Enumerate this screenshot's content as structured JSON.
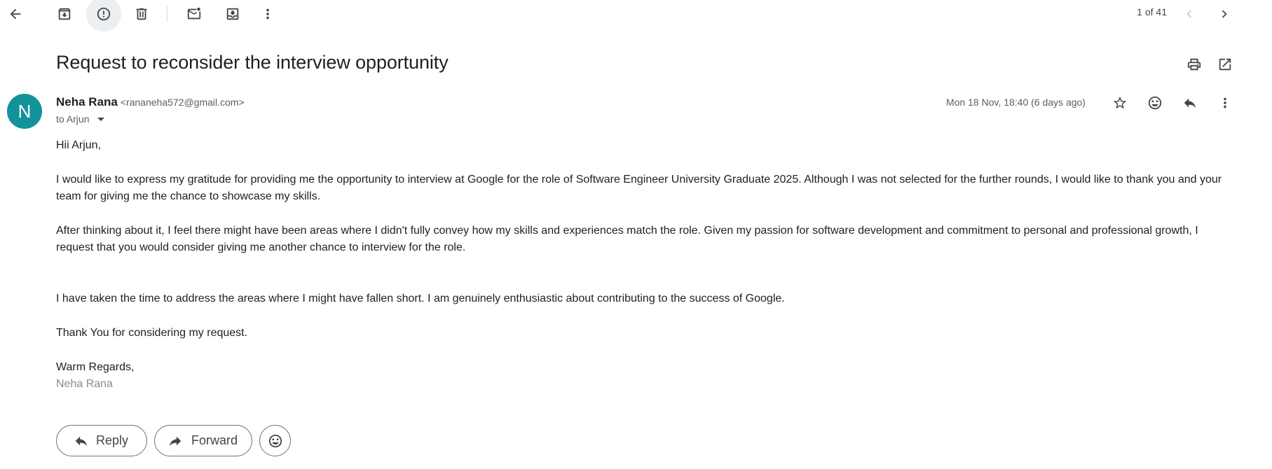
{
  "toolbar": {
    "pager_text": "1 of 41"
  },
  "email": {
    "subject": "Request to reconsider the interview opportunity",
    "avatar_letter": "N",
    "avatar_color": "#12939a",
    "sender_name": "Neha Rana",
    "sender_email": "<rananeha572@gmail.com>",
    "to_text": "to Arjun",
    "date_text": "Mon 18 Nov, 18:40 (6 days ago)",
    "body": {
      "greeting": "Hii Arjun,",
      "para1": "I would like to express my gratitude for providing me the opportunity to interview at Google for the role of Software Engineer University Graduate 2025. Although I was not selected for the further rounds, I would like to thank you and your team for giving me the chance to showcase my skills.",
      "para2": "After thinking about it, I feel there might have been areas where I didn't fully convey how my skills and experiences match the role. Given my passion for software development and commitment to personal and professional growth, I request that you would consider giving me another chance to interview for the role.",
      "para3": "I have taken the time to address the areas where I might have fallen short. I am genuinely enthusiastic about contributing to the success of Google.",
      "para4": "Thank You for considering my request.",
      "closing": "Warm Regards,",
      "signature": "Neha Rana"
    }
  },
  "actions": {
    "reply_label": "Reply",
    "forward_label": "Forward"
  },
  "icons": [
    "back-arrow-icon",
    "archive-icon",
    "report-spam-icon",
    "delete-icon",
    "mark-unread-icon",
    "move-to-icon",
    "more-vert-icon",
    "chevron-left-icon",
    "chevron-right-icon",
    "print-icon",
    "open-new-window-icon",
    "star-icon",
    "emoji-icon",
    "reply-icon",
    "forward-icon"
  ]
}
